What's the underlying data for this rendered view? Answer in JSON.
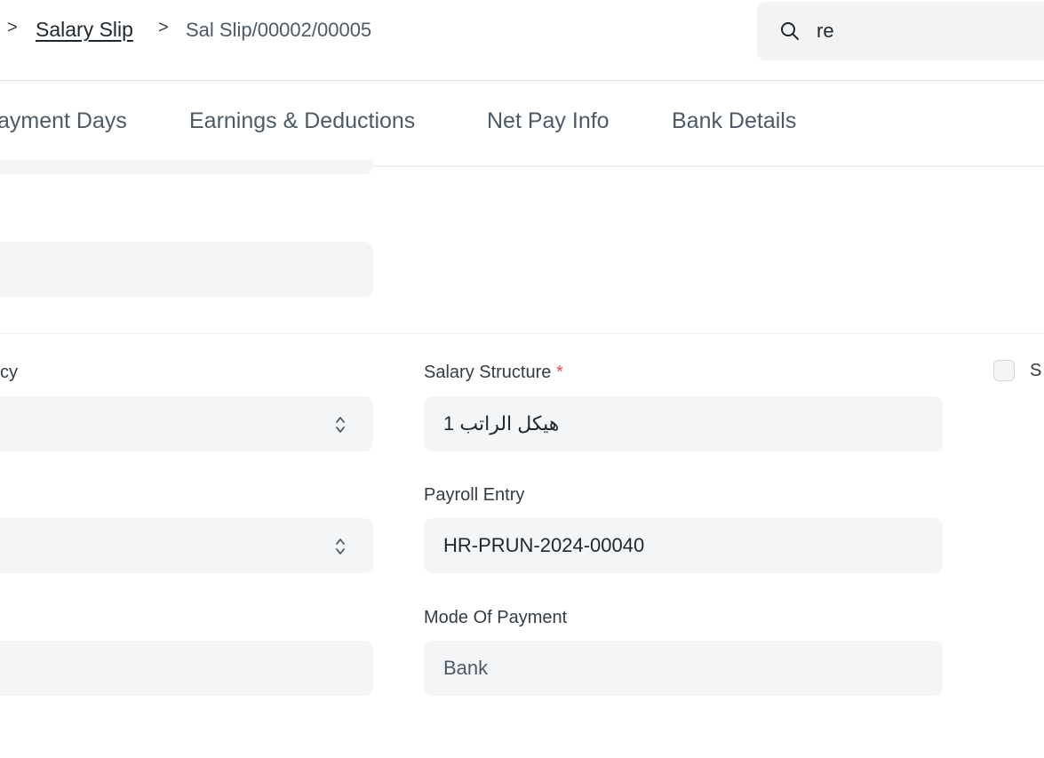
{
  "breadcrumb": {
    "separator": ">",
    "parent": "Salary Slip",
    "current": "Sal Slip/00002/00005"
  },
  "search": {
    "value": "re",
    "icon": "search-icon"
  },
  "tabs": [
    "ayment Days",
    "Earnings & Deductions",
    "Net Pay Info",
    "Bank Details"
  ],
  "form": {
    "left_partial_label": "cy",
    "salary_structure": {
      "label": "Salary Structure",
      "required_mark": "*",
      "value": "هيكل الراتب 1"
    },
    "payroll_entry": {
      "label": "Payroll Entry",
      "value": "HR-PRUN-2024-00040"
    },
    "mode_of_payment": {
      "label": "Mode Of Payment",
      "value": "Bank"
    },
    "checkbox_partial_label": "S",
    "select_icon": "chevron-up-down-icon"
  }
}
